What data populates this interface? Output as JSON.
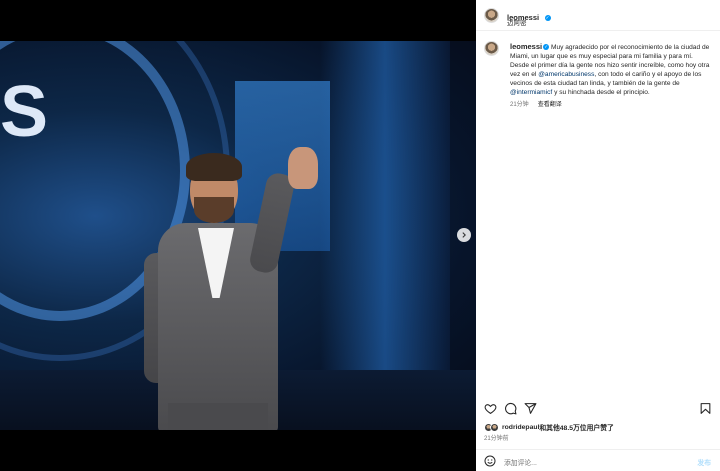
{
  "header": {
    "username": "leomessi",
    "subtitle": "迈阿密"
  },
  "post": {
    "caption_user": "leomessi",
    "caption_parts": [
      "Muy agradecido por el reconocimiento de la ciudad de Miami, un lugar que es muy especial para mi familia y para mí. Desde el primer día la gente nos hizo sentir increíble, como hoy otra vez en el ",
      "@americabusiness",
      ", con todo el cariño y el apoyo de los vecinos de esta ciudad tan linda, y también de la gente de ",
      "@intermiamicf",
      " y su hinchada desde el principio."
    ],
    "time_ago": "21分钟",
    "translate_label": "查看翻译"
  },
  "photo": {
    "backdrop_letter": "S",
    "carousel_count": 9,
    "carousel_active": 1
  },
  "engagement": {
    "liker": "rodridepaul",
    "likes_text": "和其他48.5万位用户赞了",
    "time": "21分钟前"
  },
  "comment": {
    "placeholder": "添加评论...",
    "post_label": "发布"
  },
  "icons": {
    "verified": "verified-badge-icon",
    "next": "chevron-right-icon",
    "like": "heart-icon",
    "comment": "comment-icon",
    "share": "share-icon",
    "save": "bookmark-icon",
    "emoji": "emoji-icon"
  },
  "colors": {
    "verified": "#0095f6",
    "mention": "#00376b",
    "post_button": "#b2dffc"
  }
}
